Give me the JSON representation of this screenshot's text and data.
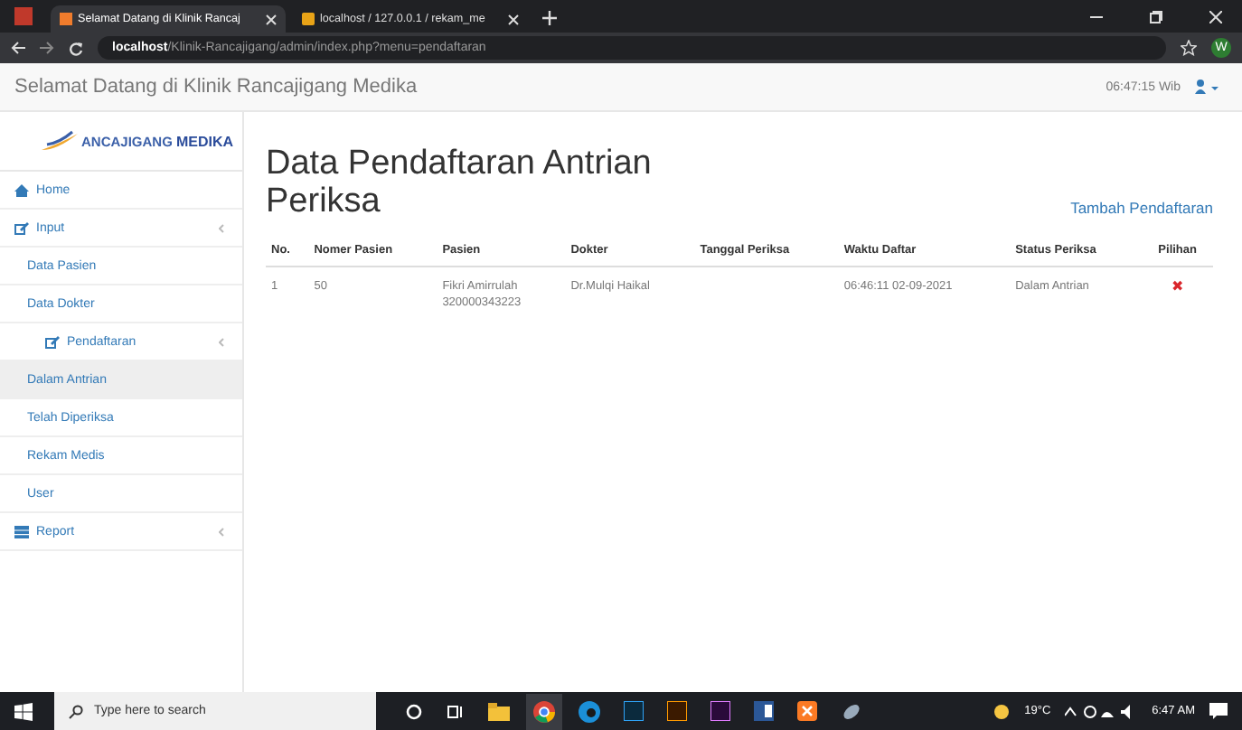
{
  "browser": {
    "tabs": [
      {
        "title": "Selamat Datang di Klinik Rancaj",
        "selected": true
      },
      {
        "title": "localhost / 127.0.0.1 / rekam_me",
        "selected": false
      }
    ],
    "url_host": "localhost",
    "url_path": "/Klinik-Rancajigang/admin/index.php?menu=pendaftaran",
    "profile": "W"
  },
  "navbar": {
    "title": "Selamat Datang di Klinik Rancajigang Medika",
    "clock": "06:47:15 Wib"
  },
  "sidebar": {
    "logo": "ANCAJIGANG",
    "logo_accent": "MEDIKA",
    "items": [
      {
        "label": "Home",
        "kind": "link"
      },
      {
        "label": "Input",
        "kind": "group",
        "children": [
          {
            "label": "Data Pasien",
            "kind": "link",
            "selected": false
          },
          {
            "label": "Data Dokter",
            "kind": "link",
            "selected": false
          },
          {
            "label": "Pendaftaran",
            "kind": "group",
            "selected": false
          },
          {
            "label": "Dalam Antrian",
            "kind": "link",
            "selected": true
          },
          {
            "label": "Telah Diperiksa",
            "kind": "link",
            "selected": false
          },
          {
            "label": "Rekam Medis",
            "kind": "link",
            "selected": false
          },
          {
            "label": "User",
            "kind": "link",
            "selected": false
          }
        ]
      },
      {
        "label": "Report",
        "kind": "group"
      }
    ]
  },
  "page": {
    "title": "Data Pendaftaran Antrian Periksa",
    "add_link": "Tambah Pendaftaran"
  },
  "table": {
    "columns": [
      "No.",
      "Nomer Pasien",
      "Pasien",
      "Dokter",
      "Tanggal Periksa",
      "Waktu Daftar",
      "Status Periksa",
      "Pilihan"
    ],
    "rows": [
      {
        "no": "1",
        "nomer": "50",
        "pasien": "Fikri Amirrulah",
        "pasien_id": "320000343223",
        "dokter": "Dr.Mulqi Haikal",
        "waktu": "06:46:11 02-09-2021",
        "status": "Dalam Antrian",
        "action": "✖"
      }
    ]
  },
  "taskbar": {
    "search_placeholder": "Type here to search",
    "weather": "19°C",
    "time": "6:47 AM"
  }
}
